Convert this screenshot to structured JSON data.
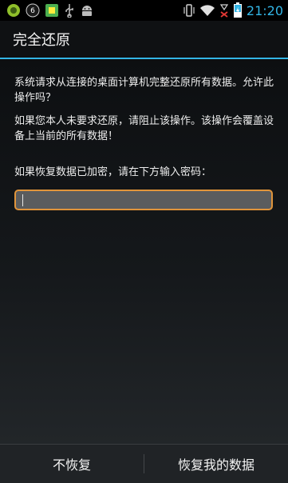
{
  "status_bar": {
    "time": "21:20",
    "notification_badge": "6",
    "icons": [
      "green-app-icon",
      "badge-icon",
      "android-app-icon",
      "usb-icon",
      "android-robot-icon",
      "vibrate-icon",
      "wifi-icon",
      "no-signal-icon",
      "battery-charging-icon"
    ],
    "time_color": "#33b5e5"
  },
  "dialog": {
    "title": "完全还原",
    "message_1": "系统请求从连接的桌面计算机完整还原所有数据。允许此操作吗？",
    "message_2": "如果您本人未要求还原，请阻止该操作。该操作会覆盖设备上当前的所有数据！",
    "password_prompt": "如果恢复数据已加密，请在下方输入密码：",
    "password_value": "",
    "deny_button": "不恢复",
    "confirm_button": "恢复我的数据"
  },
  "colors": {
    "accent": "#33b5e5",
    "field_focus": "#e0943b"
  }
}
